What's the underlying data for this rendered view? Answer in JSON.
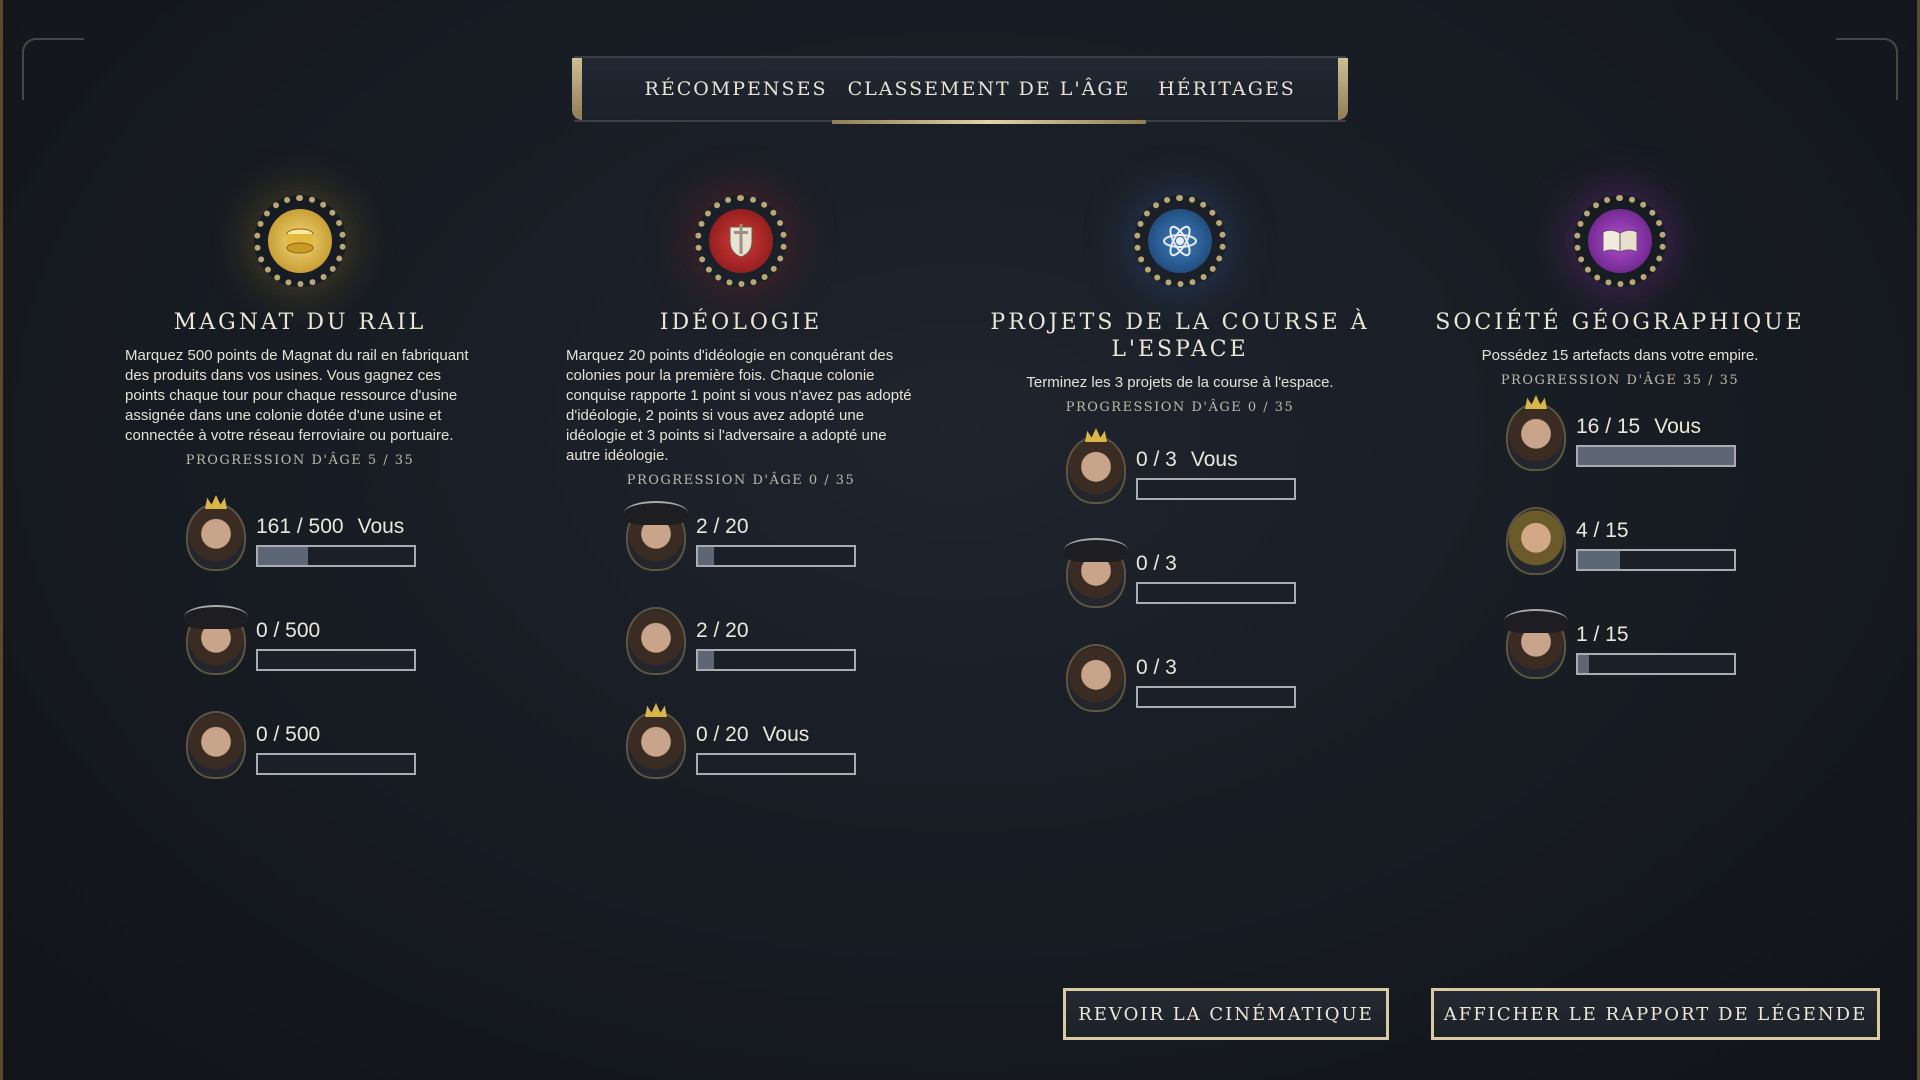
{
  "tabs": {
    "rewards": "RÉCOMPENSES",
    "ranking": "CLASSEMENT DE L'ÂGE",
    "legacies": "HÉRITAGES"
  },
  "columns": [
    {
      "icon": "gold-coins-icon",
      "title": "MAGNAT DU RAIL",
      "description": "Marquez 500 points de Magnat du rail en fabriquant des produits dans vos usines. Vous gagnez ces points chaque tour pour chaque ressource d'usine assignée dans une colonie dotée d'une usine et connectée à votre réseau ferroviaire ou portuaire.",
      "progress": "PROGRESSION D'ÂGE  5 / 35",
      "rows": [
        {
          "score": "161 / 500",
          "you": "Vous",
          "fraction": 0.322
        },
        {
          "score": "0 / 500",
          "you": "",
          "fraction": 0
        },
        {
          "score": "0 / 500",
          "you": "",
          "fraction": 0
        }
      ]
    },
    {
      "icon": "sword-shield-icon",
      "title": "IDÉOLOGIE",
      "description": "Marquez 20 points d'idéologie en conquérant des colonies pour la première fois. Chaque colonie conquise rapporte 1 point si vous n'avez pas adopté d'idéologie, 2 points si vous avez adopté une idéologie et 3 points si l'adversaire a adopté une autre idéologie.",
      "progress": "PROGRESSION D'ÂGE  0 / 35",
      "rows": [
        {
          "score": "2 / 20",
          "you": "",
          "fraction": 0.1
        },
        {
          "score": "2 / 20",
          "you": "",
          "fraction": 0.1
        },
        {
          "score": "0 / 20",
          "you": "Vous",
          "fraction": 0
        }
      ]
    },
    {
      "icon": "atom-icon",
      "title": "PROJETS DE LA COURSE À L'ESPACE",
      "description": "Terminez les 3 projets de la course à l'espace.",
      "progress": "PROGRESSION D'ÂGE  0 / 35",
      "rows": [
        {
          "score": "0 / 3",
          "you": "Vous",
          "fraction": 0
        },
        {
          "score": "0 / 3",
          "you": "",
          "fraction": 0
        },
        {
          "score": "0 / 3",
          "you": "",
          "fraction": 0
        }
      ]
    },
    {
      "icon": "open-book-icon",
      "title": "SOCIÉTÉ GÉOGRAPHIQUE",
      "description": "Possédez 15 artefacts dans votre empire.",
      "progress": "PROGRESSION D'ÂGE  35 / 35",
      "rows": [
        {
          "score": "16 / 15",
          "you": "Vous",
          "fraction": 1.0
        },
        {
          "score": "4 / 15",
          "you": "",
          "fraction": 0.27
        },
        {
          "score": "1 / 15",
          "you": "",
          "fraction": 0.07
        }
      ]
    }
  ],
  "buttons": {
    "replay": "REVOIR LA CINÉMATIQUE",
    "report": "AFFICHER LE RAPPORT DE LÉGENDE"
  },
  "colors": {
    "gold": "#d9cba1",
    "bar_fill": "#5d6675"
  }
}
